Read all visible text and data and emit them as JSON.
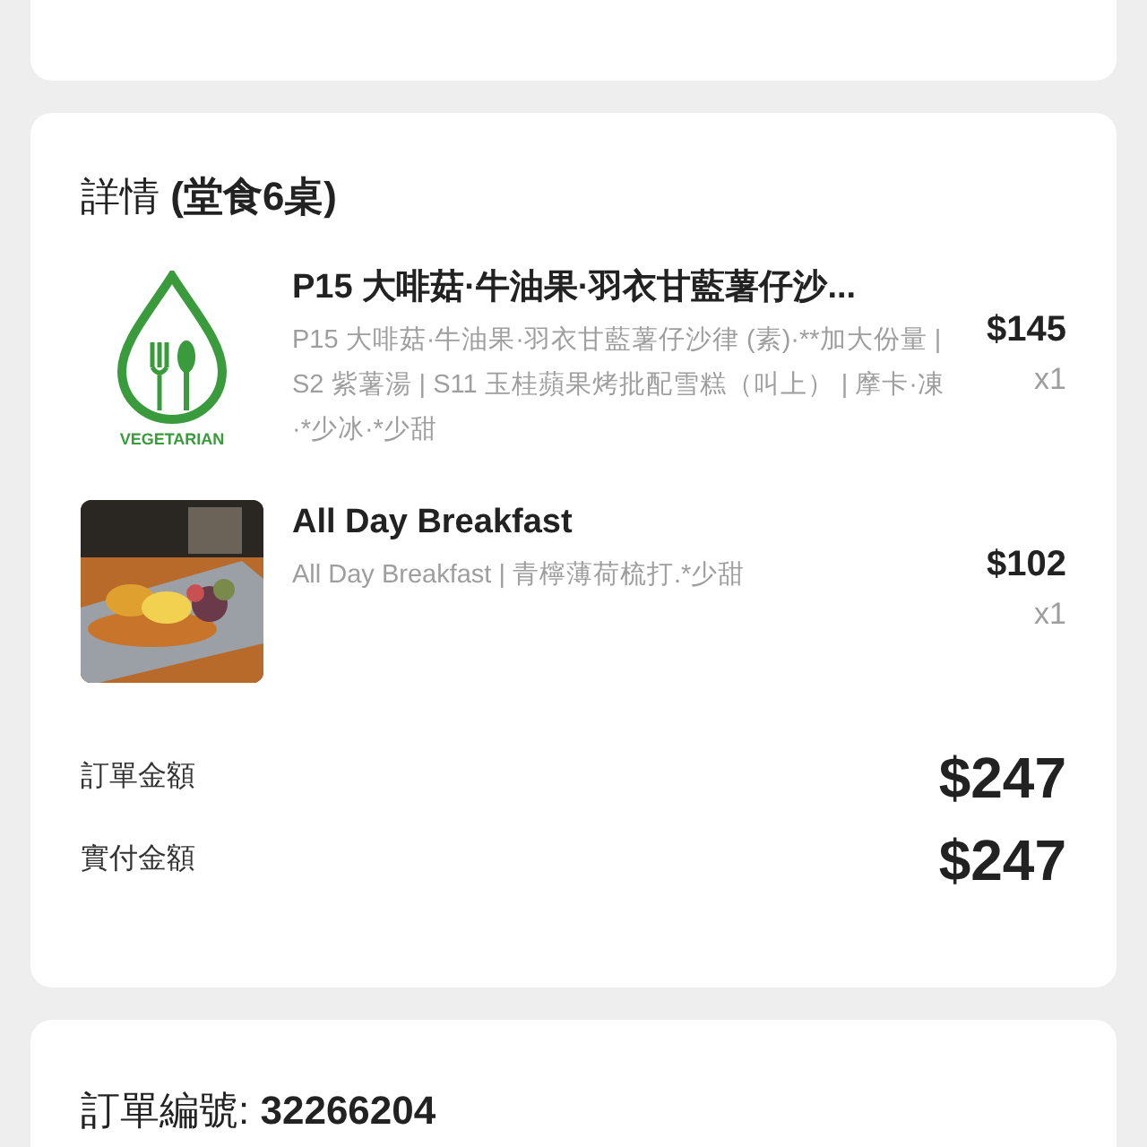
{
  "details": {
    "heading": "詳情 **(堂食6桌)**",
    "items": [
      {
        "kind": "logo",
        "logo_text": "VEGETARIAN",
        "title": "P15 大啡菇·牛油果·羽衣甘藍薯仔沙...",
        "description": "P15 大啡菇·牛油果·羽衣甘藍薯仔沙律 (素)·**加大份量 | S2 紫薯湯 | S11 玉桂蘋果烤批配雪糕（叫上） | 摩卡·凍·*少冰·*少甜",
        "price": "$145",
        "quantity": "x1"
      },
      {
        "kind": "picture",
        "title": "All Day Breakfast",
        "description": "All Day Breakfast | 青檸薄荷梳打.*少甜",
        "price": "$102",
        "quantity": "x1"
      }
    ],
    "totals": [
      {
        "label": "訂單金額",
        "amount": "$247"
      },
      {
        "label": "實付金額",
        "amount": "$247"
      }
    ]
  },
  "order": {
    "number_line": "訂單編號: **32266204**"
  }
}
